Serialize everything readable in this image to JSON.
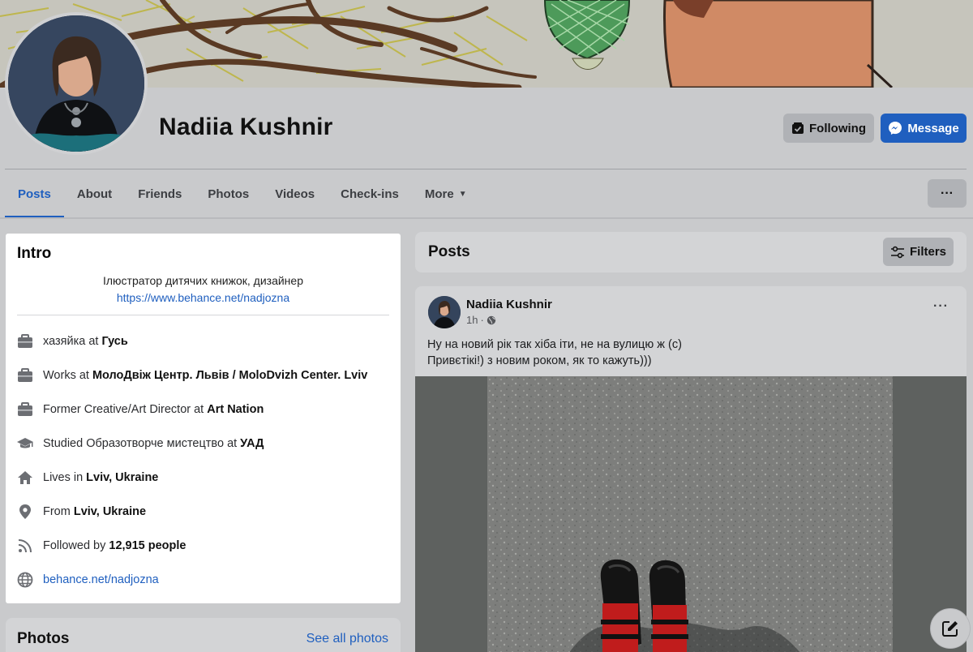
{
  "profile": {
    "name": "Nadiia Kushnir",
    "following_label": "Following",
    "message_label": "Message",
    "more_label": "···"
  },
  "tabs": [
    {
      "label": "Posts"
    },
    {
      "label": "About"
    },
    {
      "label": "Friends"
    },
    {
      "label": "Photos"
    },
    {
      "label": "Videos"
    },
    {
      "label": "Check-ins"
    },
    {
      "label": "More"
    }
  ],
  "intro": {
    "title": "Intro",
    "bio": "Ілюстратор дитячих книжок, дизайнер",
    "bio_link": "https://www.behance.net/nadjozna",
    "items": [
      {
        "icon": "briefcase-icon",
        "prefix": "хазяйка at",
        "bold": "Гусь"
      },
      {
        "icon": "briefcase-icon",
        "prefix": "Works at",
        "bold": "МолоДвіж Центр. Львів / MoloDvizh Center. Lviv"
      },
      {
        "icon": "briefcase-icon",
        "prefix": "Former Creative/Art Director at",
        "bold": "Art Nation"
      },
      {
        "icon": "graduation-cap-icon",
        "prefix": "Studied Образотворче мистецтво at",
        "bold": "УАД"
      },
      {
        "icon": "home-icon",
        "prefix": "Lives in",
        "bold": "Lviv, Ukraine"
      },
      {
        "icon": "location-pin-icon",
        "prefix": "From",
        "bold": "Lviv, Ukraine"
      },
      {
        "icon": "rss-icon",
        "prefix": "Followed by",
        "bold": "12,915 people"
      },
      {
        "icon": "globe-icon",
        "link": "behance.net/nadjozna"
      }
    ]
  },
  "photos_card": {
    "title": "Photos",
    "see_all": "See all photos"
  },
  "posts_header": {
    "title": "Posts",
    "filters_label": "Filters"
  },
  "post": {
    "author": "Nadiia Kushnir",
    "time": "1h",
    "separator": "·",
    "more": "···",
    "text_line1": "Ну на новий рік так хіба іти, не на вулицю ж (с)",
    "text_line2": "Привєтікі!) з новим роком, як то кажуть)))"
  },
  "colors": {
    "accent": "#1f5fbf",
    "dimmed_background": "#c9cacc",
    "card_highlight": "#ffffff"
  }
}
